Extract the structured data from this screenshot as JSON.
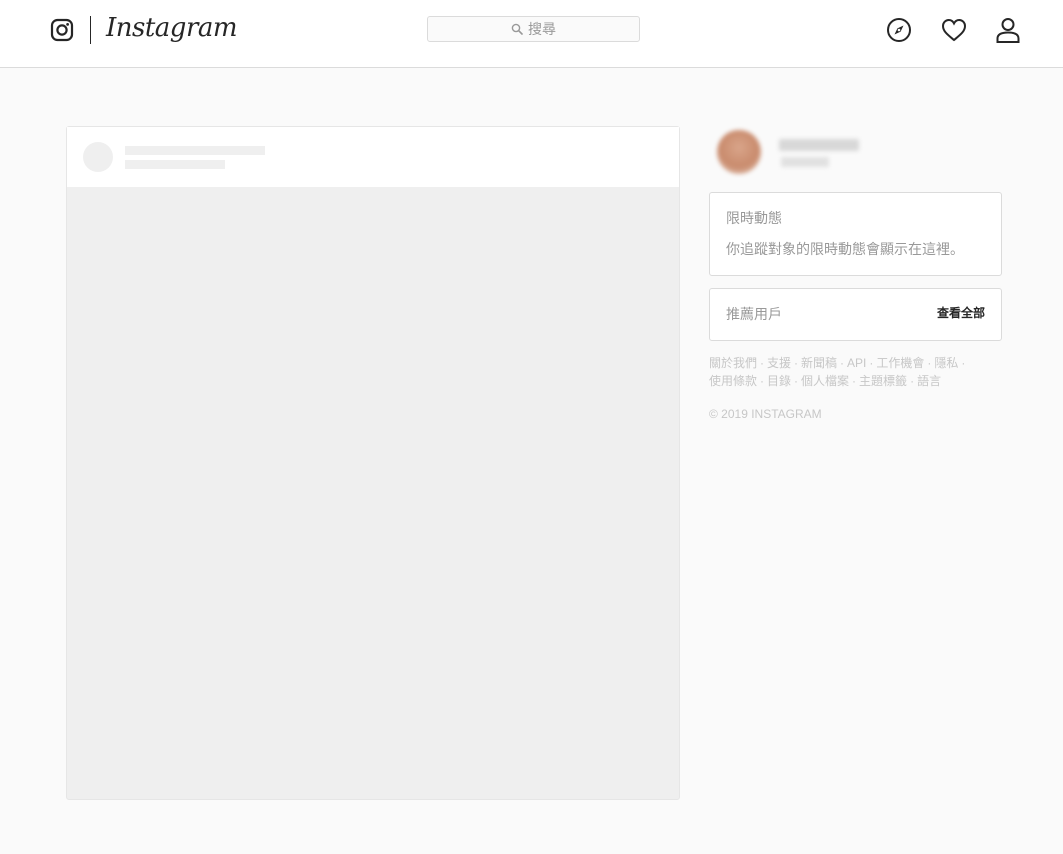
{
  "header": {
    "brand": "Instagram",
    "search_placeholder": "搜尋",
    "nav_icons": [
      "compass-icon",
      "heart-icon",
      "profile-icon"
    ]
  },
  "sidebar": {
    "stories": {
      "title": "限時動態",
      "empty_text": "你追蹤對象的限時動態會顯示在這裡。"
    },
    "suggestions": {
      "title": "推薦用戶",
      "see_all": "查看全部"
    },
    "footer": {
      "links": [
        "關於我們",
        "支援",
        "新聞稿",
        "API",
        "工作機會",
        "隱私",
        "使用條款",
        "目錄",
        "個人檔案",
        "主題標籤",
        "語言"
      ],
      "copyright": "© 2019 INSTAGRAM"
    }
  },
  "colors": {
    "background": "#fafafa",
    "border": "#dbdbdb",
    "muted_text": "#999999",
    "footer_text": "#c7c7c7",
    "placeholder": "#efefef"
  }
}
